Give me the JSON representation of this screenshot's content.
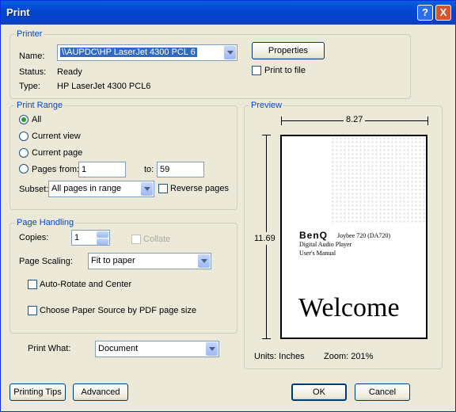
{
  "window": {
    "title": "Print",
    "help_label": "?",
    "close_label": "X"
  },
  "printer": {
    "group_label": "Printer",
    "name_label": "Name:",
    "name_value": "\\\\AUPDC\\HP LaserJet 4300 PCL 6",
    "status_label": "Status:",
    "status_value": "Ready",
    "type_label": "Type:",
    "type_value": "HP LaserJet 4300 PCL6",
    "properties_label": "Properties",
    "print_to_file_label": "Print to file"
  },
  "print_range": {
    "group_label": "Print Range",
    "all_label": "All",
    "current_view_label": "Current view",
    "current_page_label": "Current page",
    "pages_label": "Pages",
    "from_label": "from:",
    "from_value": "1",
    "to_label": "to:",
    "to_value": "59",
    "subset_label": "Subset:",
    "subset_value": "All pages in range",
    "reverse_label": "Reverse pages",
    "selected": "All"
  },
  "page_handling": {
    "group_label": "Page Handling",
    "copies_label": "Copies:",
    "copies_value": "1",
    "collate_label": "Collate",
    "scaling_label": "Page Scaling:",
    "scaling_value": "Fit to paper",
    "auto_rotate_label": "Auto-Rotate and Center",
    "paper_source_label": "Choose Paper Source by PDF page size"
  },
  "print_what": {
    "label": "Print What:",
    "value": "Document"
  },
  "preview": {
    "group_label": "Preview",
    "width_value": "8.27",
    "height_value": "11.69",
    "units": "Units: Inches",
    "zoom": "Zoom: 201%",
    "page": {
      "brand": "BenQ",
      "product": "Joybee 720 (DA720)",
      "line2": "Digital Audio Player",
      "line3": "User's Manual",
      "headline": "Welcome"
    }
  },
  "buttons": {
    "printing_tips": "Printing Tips",
    "advanced": "Advanced",
    "ok": "OK",
    "cancel": "Cancel"
  }
}
